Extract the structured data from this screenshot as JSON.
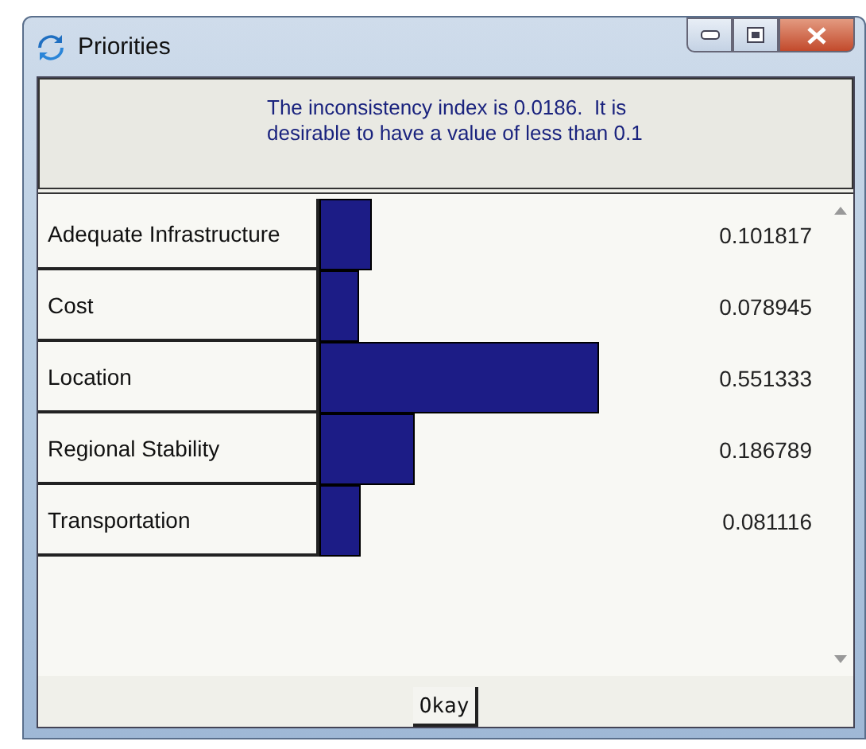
{
  "window": {
    "title": "Priorities"
  },
  "message": "The inconsistency index is 0.0186.  It is desirable to have a value of less than 0.1",
  "rows": [
    {
      "label": "Adequate Infrastructure",
      "value": "0.101817",
      "level": 0.101817
    },
    {
      "label": "Cost",
      "value": "0.078945",
      "level": 0.078945
    },
    {
      "label": "Location",
      "value": "0.551333",
      "level": 0.551333
    },
    {
      "label": "Regional Stability",
      "value": "0.186789",
      "level": 0.186789
    },
    {
      "label": "Transportation",
      "value": "0.081116",
      "level": 0.081116
    }
  ],
  "buttons": [
    "Okay"
  ]
}
